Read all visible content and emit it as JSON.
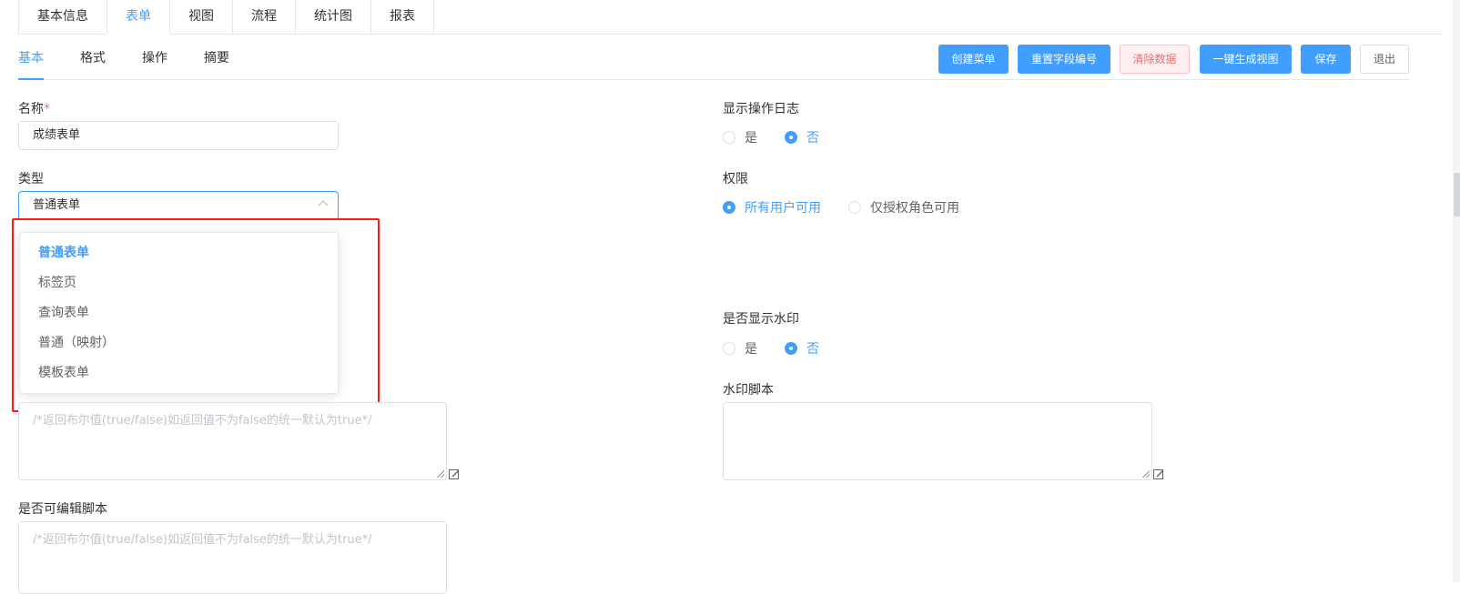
{
  "top_tabs": [
    "基本信息",
    "表单",
    "视图",
    "流程",
    "统计图",
    "报表"
  ],
  "active_top_tab": "表单",
  "sub_tabs": [
    "基本",
    "格式",
    "操作",
    "摘要"
  ],
  "active_sub_tab": "基本",
  "toolbar": {
    "create_menu": "创建菜单",
    "reset_field_number": "重置字段编号",
    "clear_data": "清除数据",
    "generate_view": "一键生成视图",
    "save": "保存",
    "exit": "退出"
  },
  "form": {
    "name_label": "名称",
    "required_mark": "*",
    "name_value": "成绩表单",
    "type_label": "类型",
    "type_value": "普通表单",
    "type_options": [
      "普通表单",
      "标签页",
      "查询表单",
      "普通（映射）",
      "模板表单"
    ],
    "type_selected": "普通表单",
    "show_log_label": "显示操作日志",
    "show_log_options": [
      "是",
      "否"
    ],
    "show_log_selected": "否",
    "permission_label": "权限",
    "permission_options": [
      "所有用户可用",
      "仅授权角色可用"
    ],
    "permission_selected": "所有用户可用",
    "watermark_label": "是否显示水印",
    "watermark_options": [
      "是",
      "否"
    ],
    "watermark_selected": "否",
    "watermark_script_label": "水印脚本",
    "script_placeholder": "/*返回布尔值(true/false)如返回值不为false的统一默认为true*/",
    "editable_script_label": "是否可编辑脚本"
  },
  "colors": {
    "accent": "#409eff",
    "danger": "#f56c6c",
    "highlight_box": "#ff1a1a"
  }
}
